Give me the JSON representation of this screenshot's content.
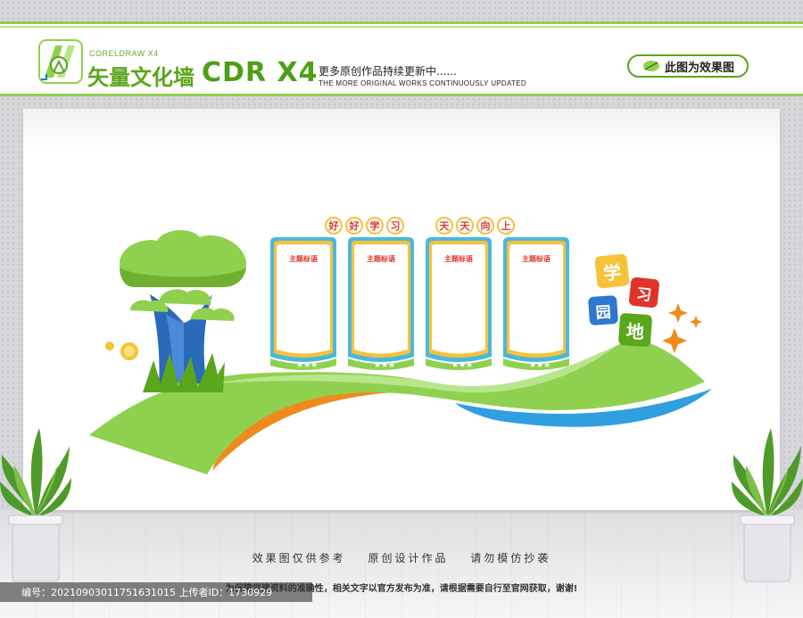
{
  "header": {
    "brand_small": "CORELDRAW X4",
    "brand_title": "矢量文化墙",
    "brand_cdr": "CDR X4",
    "tagline_cn": "更多原创作品持续更新中......",
    "tagline_en": "THE MORE ORIGINAL WORKS CONTINUOUSLY UPDATED",
    "effect_button": "此图为效果图"
  },
  "slogans": {
    "left": [
      "好",
      "好",
      "学",
      "习"
    ],
    "right": [
      "天",
      "天",
      "向",
      "上"
    ]
  },
  "frames": [
    {
      "title": "主题标语"
    },
    {
      "title": "主题标语"
    },
    {
      "title": "主题标语"
    },
    {
      "title": "主题标语"
    }
  ],
  "tiles": [
    {
      "char": "学",
      "color": "#f6c23b"
    },
    {
      "char": "习",
      "color": "#e0342a"
    },
    {
      "char": "园",
      "color": "#2f78d0"
    },
    {
      "char": "地",
      "color": "#5aa61c"
    }
  ],
  "footer": {
    "line1": "效果图仅供参考   原创设计作品   请勿模仿抄袭",
    "line2": "为保障党建资料的准确性，相关文字以官方发布为准，请根据需要自行至官网获取，谢谢!",
    "id_text": "编号：20210903011751631015 上传者ID：1730929"
  },
  "colors": {
    "green": "#8fd14f",
    "dark_green": "#5aa61c",
    "blue": "#2f78d0",
    "orange": "#f08a1c",
    "cyan": "#49b8de"
  }
}
